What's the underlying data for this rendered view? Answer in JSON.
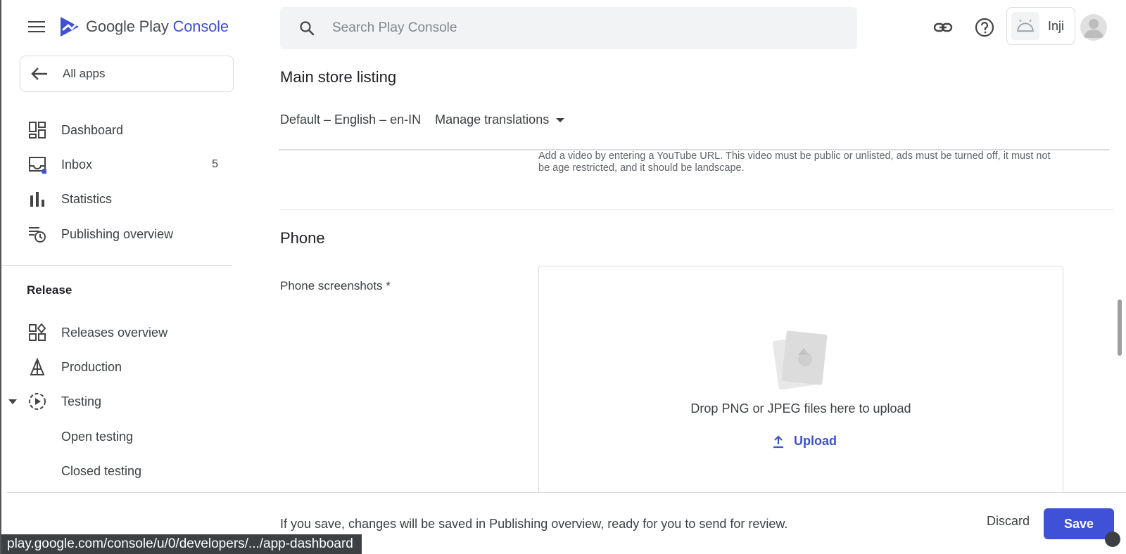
{
  "header": {
    "logo_brand": "Google Play",
    "logo_product": "Console",
    "search_placeholder": "Search Play Console",
    "app_name": "Inji"
  },
  "sidebar": {
    "all_apps_label": "All apps",
    "items": [
      {
        "label": "Dashboard",
        "icon": "dashboard-icon"
      },
      {
        "label": "Inbox",
        "icon": "inbox-icon",
        "count": "5"
      },
      {
        "label": "Statistics",
        "icon": "statistics-icon"
      },
      {
        "label": "Publishing overview",
        "icon": "publishing-overview-icon"
      }
    ],
    "release_heading": "Release",
    "release_items": [
      {
        "label": "Releases overview",
        "icon": "releases-overview-icon"
      },
      {
        "label": "Production",
        "icon": "production-icon"
      },
      {
        "label": "Testing",
        "icon": "testing-icon"
      },
      {
        "label": "Open testing"
      },
      {
        "label": "Closed testing"
      }
    ]
  },
  "main": {
    "title": "Main store listing",
    "language": "Default – English – en-IN",
    "manage_translations": "Manage translations",
    "video_helper": "Add a video by entering a YouTube URL. This video must be public or unlisted, ads must be turned off, it must not be age restricted, and it should be landscape.",
    "phone_title": "Phone",
    "phone_screenshots_label": "Phone screenshots  *",
    "dropzone_text": "Drop PNG or JPEG files here to upload",
    "upload_label": "Upload"
  },
  "footer": {
    "message": "If you save, changes will be saved in Publishing overview, ready for you to send for review.",
    "discard_label": "Discard",
    "save_label": "Save"
  },
  "status_bar": {
    "url": "play.google.com/console/u/0/developers/.../app-dashboard"
  },
  "colors": {
    "accent": "#3f51d6",
    "inbox_dot": "#3f51d6"
  }
}
